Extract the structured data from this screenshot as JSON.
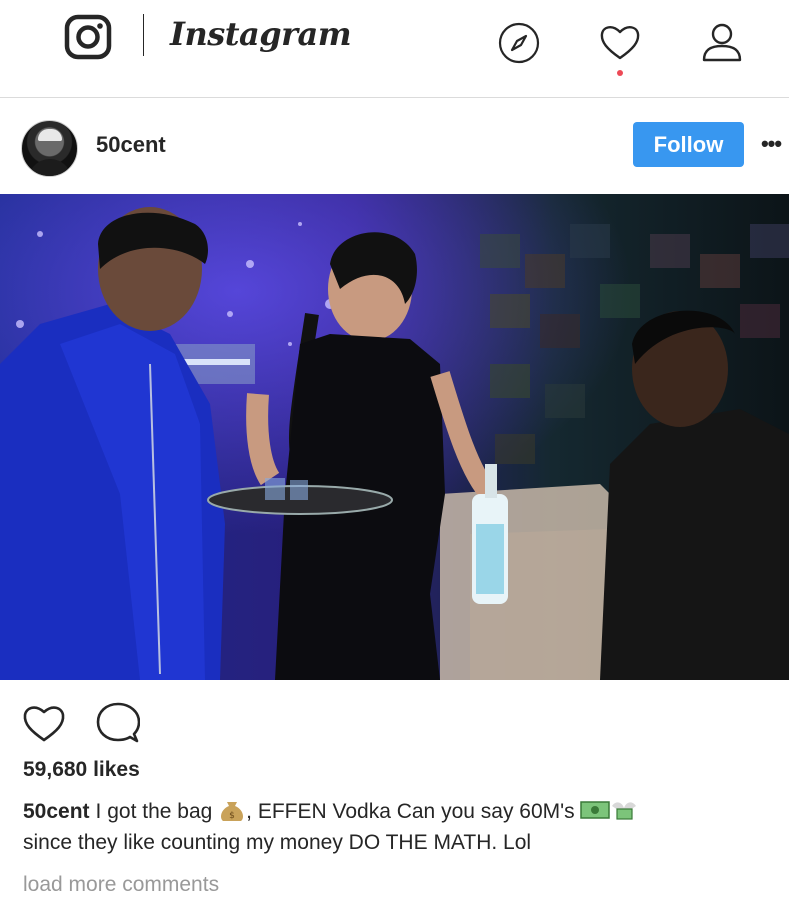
{
  "topnav": {
    "wordmark": "Instagram",
    "icons": [
      "instagram-camera-icon",
      "explore-compass-icon",
      "activity-heart-icon",
      "profile-person-icon"
    ],
    "notification_dot_color": "#ed4956"
  },
  "post": {
    "username": "50cent",
    "follow_label": "Follow",
    "more_label": "•••",
    "follow_color": "#3897f0",
    "likes": "59,680 likes",
    "caption": {
      "user": "50cent",
      "text_part1": "I got the bag",
      "text_part2": ", EFFEN Vodka Can you say 60M's",
      "text_part3": "since they like counting my money DO THE MATH. Lol",
      "emojis": [
        "money-bag-emoji",
        "dollar-banknote-emoji",
        "money-with-wings-emoji"
      ]
    },
    "load_more_label": "load more comments"
  }
}
